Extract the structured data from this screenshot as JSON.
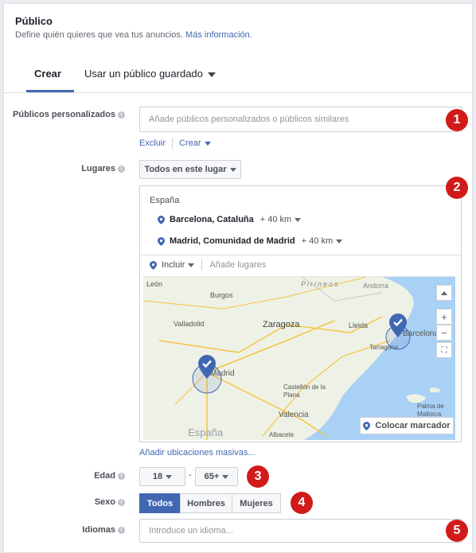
{
  "header": {
    "title": "Público",
    "subtitle": "Define quién quieres que vea tus anuncios.",
    "more_info": "Más información."
  },
  "tabs": {
    "create": "Crear",
    "saved": "Usar un público guardado"
  },
  "custom_audiences": {
    "label": "Públicos personalizados",
    "placeholder": "Añade públicos personalizados o públicos similares",
    "exclude": "Excluir",
    "create": "Crear"
  },
  "locations": {
    "label": "Lugares",
    "scope": "Todos en este lugar",
    "country": "España",
    "items": [
      {
        "name": "Barcelona, Cataluña",
        "radius": "+ 40 km"
      },
      {
        "name": "Madrid, Comunidad de Madrid",
        "radius": "+ 40 km"
      }
    ],
    "include": "Incluir",
    "add_placeholder": "Añade lugares",
    "bulk_link": "Añadir ubicaciones masivas...",
    "place_marker": "Colocar marcador",
    "map_labels": [
      "León",
      "Burgos",
      "Pirineos",
      "Andorra",
      "Valladolid",
      "Zaragoza",
      "Lleida",
      "Barcelona",
      "Tarragona",
      "Madrid",
      "Castellón de la Plana",
      "Valencia",
      "Palma de Mallorca",
      "España",
      "Albacete"
    ]
  },
  "age": {
    "label": "Edad",
    "min": "18",
    "max": "65+",
    "dash": "-"
  },
  "gender": {
    "label": "Sexo",
    "options": [
      "Todos",
      "Hombres",
      "Mujeres"
    ]
  },
  "languages": {
    "label": "Idiomas",
    "placeholder": "Introduce un idioma..."
  },
  "badges": [
    "1",
    "2",
    "3",
    "4",
    "5"
  ],
  "colors": {
    "accent": "#4267b2",
    "badge": "#d11b1b",
    "sea": "#a9d0f5"
  }
}
